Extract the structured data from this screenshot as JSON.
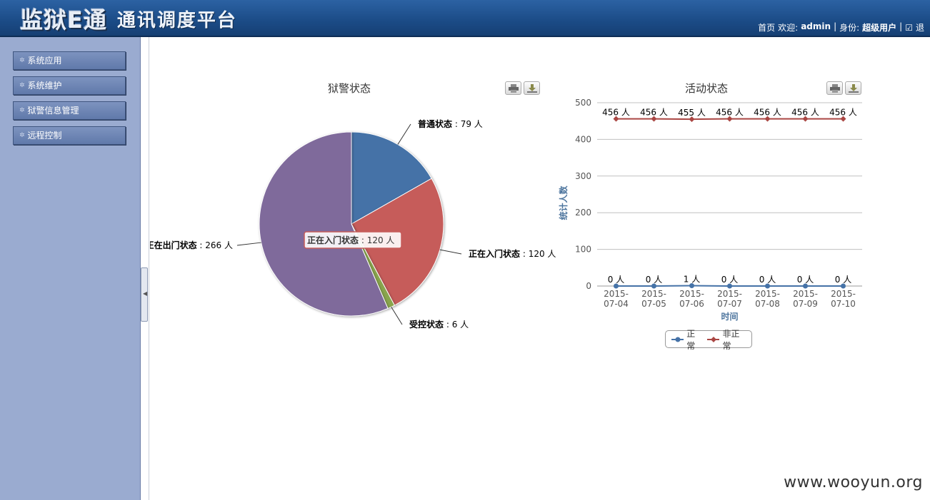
{
  "header": {
    "brand": "监狱E通",
    "subtitle": "通讯调度平台",
    "home": "首页",
    "welcome_prefix": "欢迎:",
    "username": "admin",
    "role_prefix": "身份:",
    "role": "超级用户",
    "logout": "退"
  },
  "sidebar": {
    "items": [
      {
        "label": "系统应用"
      },
      {
        "label": "系统维护"
      },
      {
        "label": "狱警信息管理"
      },
      {
        "label": "远程控制"
      }
    ]
  },
  "pie_panel": {
    "title": "狱警状态"
  },
  "line_panel": {
    "title": "活动状态"
  },
  "chart_data": [
    {
      "type": "pie",
      "title": "狱警状态",
      "unit": "人",
      "slices": [
        {
          "label": "普通状态",
          "value": 79,
          "color": "#4572a7"
        },
        {
          "label": "正在入门状态",
          "value": 120,
          "color": "#c65c5a"
        },
        {
          "label": "受控状态",
          "value": 6,
          "color": "#89a54e"
        },
        {
          "label": "正在出门状态",
          "value": 266,
          "color": "#7f6a9b"
        }
      ],
      "tooltip": {
        "label": "正在入门状态",
        "value_text": "120 人"
      }
    },
    {
      "type": "line",
      "title": "活动状态",
      "xlabel": "时间",
      "ylabel": "统计人数",
      "ylim": [
        0,
        500
      ],
      "yticks": [
        0,
        100,
        200,
        300,
        400,
        500
      ],
      "categories": [
        "2015-07-04",
        "2015-07-05",
        "2015-07-06",
        "2015-07-07",
        "2015-07-08",
        "2015-07-09",
        "2015-07-10"
      ],
      "series": [
        {
          "name": "正常",
          "color": "#4572a7",
          "values": [
            0,
            0,
            1,
            0,
            0,
            0,
            0
          ]
        },
        {
          "name": "非正常",
          "color": "#aa4643",
          "values": [
            456,
            456,
            455,
            456,
            456,
            456,
            456
          ]
        }
      ],
      "value_suffix": " 人",
      "legend_position": "bottom"
    }
  ],
  "watermark": "www.wooyun.org"
}
